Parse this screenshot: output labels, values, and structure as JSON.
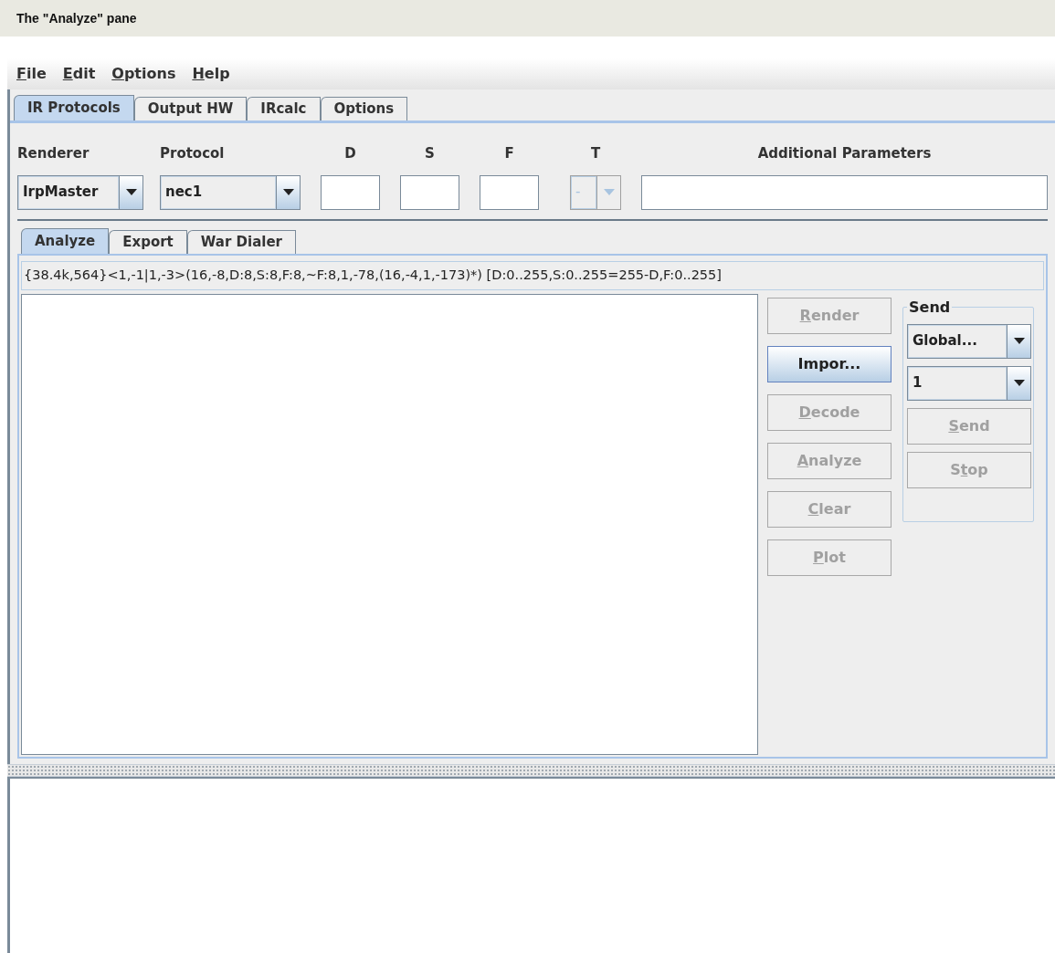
{
  "caption": "The \"Analyze\" pane",
  "menu": [
    {
      "label": {
        "key": "F",
        "after": "ile"
      }
    },
    {
      "label": {
        "key": "E",
        "after": "dit"
      }
    },
    {
      "label": {
        "key": "O",
        "after": "ptions"
      }
    },
    {
      "label": {
        "key": "H",
        "after": "elp"
      }
    }
  ],
  "tabs": [
    {
      "label": "IR Protocols",
      "selected": true
    },
    {
      "label": "Output HW",
      "selected": false
    },
    {
      "label": "IRcalc",
      "selected": false
    },
    {
      "label": "Options",
      "selected": false
    }
  ],
  "params": {
    "renderer": {
      "label": "Renderer",
      "value": "IrpMaster"
    },
    "protocol": {
      "label": "Protocol",
      "value": "nec1"
    },
    "d": {
      "label": "D"
    },
    "s": {
      "label": "S"
    },
    "f": {
      "label": "F"
    },
    "t": {
      "label": "T",
      "value": "-",
      "disabled": true
    },
    "additional": {
      "label": "Additional Parameters"
    }
  },
  "subtabs": [
    {
      "label": "Analyze",
      "selected": true
    },
    {
      "label": "Export",
      "selected": false
    },
    {
      "label": "War Dialer",
      "selected": false
    }
  ],
  "irp": "{38.4k,564}<1,-1|1,-3>(16,-8,D:8,S:8,F:8,~F:8,1,-78,(16,-4,1,-173)*) [D:0..255,S:0..255=255-D,F:0..255]",
  "buttons": [
    {
      "label": {
        "key": "R",
        "after": "ender"
      },
      "disabled": true,
      "focused": false
    },
    {
      "label": {
        "before": "Impor..."
      },
      "disabled": false,
      "focused": true
    },
    {
      "label": {
        "key": "D",
        "after": "ecode"
      },
      "disabled": true,
      "focused": false
    },
    {
      "label": {
        "key": "A",
        "after": "nalyze"
      },
      "disabled": true,
      "focused": false
    },
    {
      "label": {
        "key": "C",
        "after": "lear"
      },
      "disabled": true,
      "focused": false
    },
    {
      "label": {
        "key": "P",
        "after": "lot"
      },
      "disabled": true,
      "focused": false
    }
  ],
  "send": {
    "title": "Send",
    "port": "Global...",
    "count": "1",
    "buttons": [
      {
        "label": {
          "key": "S",
          "after": "end"
        },
        "disabled": true
      },
      {
        "label": {
          "before": "S",
          "key": "t",
          "after": "op"
        },
        "disabled": true
      }
    ]
  }
}
